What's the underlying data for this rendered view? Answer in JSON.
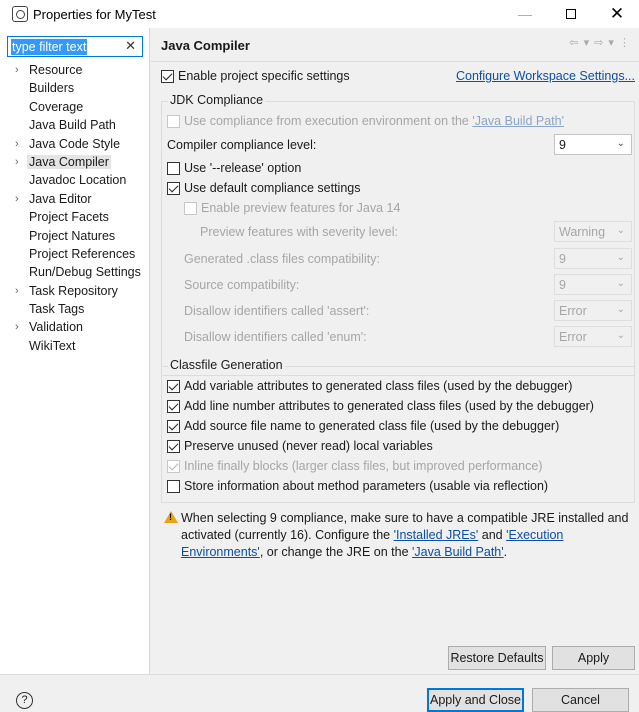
{
  "window": {
    "title": "Properties for MyTest",
    "minimize": "—",
    "close": "✕"
  },
  "filter": {
    "value": "type filter text",
    "clear_icon": "✕"
  },
  "tree": {
    "items": [
      {
        "label": "Resource",
        "expandable": true
      },
      {
        "label": "Builders",
        "expandable": false
      },
      {
        "label": "Coverage",
        "expandable": false
      },
      {
        "label": "Java Build Path",
        "expandable": false
      },
      {
        "label": "Java Code Style",
        "expandable": true
      },
      {
        "label": "Java Compiler",
        "expandable": true,
        "selected": true
      },
      {
        "label": "Javadoc Location",
        "expandable": false
      },
      {
        "label": "Java Editor",
        "expandable": true
      },
      {
        "label": "Project Facets",
        "expandable": false
      },
      {
        "label": "Project Natures",
        "expandable": false
      },
      {
        "label": "Project References",
        "expandable": false
      },
      {
        "label": "Run/Debug Settings",
        "expandable": false
      },
      {
        "label": "Task Repository",
        "expandable": true
      },
      {
        "label": "Task Tags",
        "expandable": false
      },
      {
        "label": "Validation",
        "expandable": true
      },
      {
        "label": "WikiText",
        "expandable": false
      }
    ]
  },
  "page": {
    "title": "Java Compiler",
    "nav_icons": "⇦ ▾ ⇨ ▾ ⋮",
    "enable_project_settings": "Enable project specific settings",
    "configure_workspace_link": "Configure Workspace Settings..."
  },
  "jdk": {
    "group_title": "JDK Compliance",
    "use_ee_prefix": "Use compliance from execution environment on the ",
    "use_ee_link": "'Java Build Path'",
    "compliance_label": "Compiler compliance level:",
    "compliance_value": "9",
    "release_option": "Use '--release' option",
    "default_compliance": "Use default compliance settings",
    "enable_preview": "Enable preview features for Java 14",
    "preview_severity_label": "Preview features with severity level:",
    "preview_severity_value": "Warning",
    "generated_label": "Generated .class files compatibility:",
    "generated_value": "9",
    "source_label": "Source compatibility:",
    "source_value": "9",
    "assert_label": "Disallow identifiers called 'assert':",
    "assert_value": "Error",
    "enum_label": "Disallow identifiers called 'enum':",
    "enum_value": "Error"
  },
  "classfile": {
    "group_title": "Classfile Generation",
    "opt1": "Add variable attributes to generated class files (used by the debugger)",
    "opt2": "Add line number attributes to generated class files (used by the debugger)",
    "opt3": "Add source file name to generated class file (used by the debugger)",
    "opt4": "Preserve unused (never read) local variables",
    "opt5": "Inline finally blocks (larger class files, but improved performance)",
    "opt6": "Store information about method parameters (usable via reflection)"
  },
  "warning": {
    "line1": "When selecting 9 compliance, make sure to have a compatible JRE installed and",
    "line2_a": "activated (currently 16). Configure the ",
    "line2_link1": "'Installed JREs'",
    "line2_b": " and ",
    "line2_link2": "'Execution",
    "line3_link2": "Environments'",
    "line3_a": ", or change the JRE on the ",
    "line3_link3": "'Java Build Path'",
    "line3_b": "."
  },
  "buttons": {
    "restore_defaults": "Restore Defaults",
    "apply": "Apply",
    "apply_and_close": "Apply and Close",
    "cancel": "Cancel",
    "help": "?"
  }
}
